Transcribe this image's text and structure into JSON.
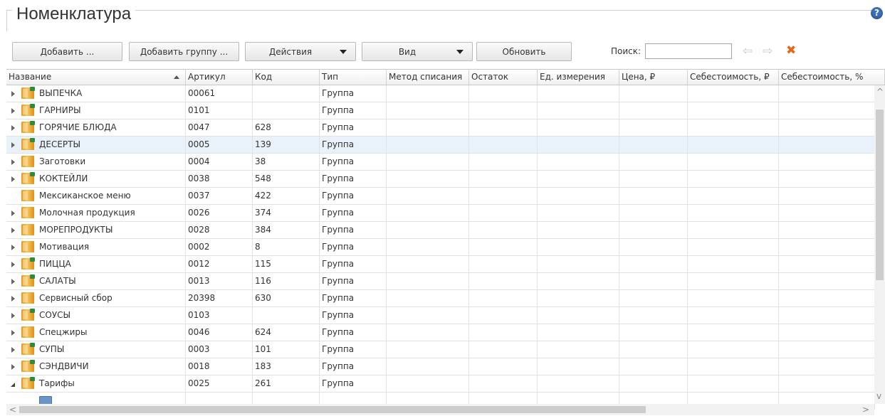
{
  "title": "Номенклатура",
  "help_icon": "?",
  "toolbar": {
    "add": "Добавить ...",
    "add_group": "Добавить группу ...",
    "actions": "Действия",
    "view": "Вид",
    "refresh": "Обновить",
    "search_label": "Поиск:",
    "search_value": ""
  },
  "icons": {
    "back": "⇦",
    "forward": "⇨",
    "clear": "✖"
  },
  "columns": [
    "Название",
    "Артикул",
    "Код",
    "Тип",
    "Метод списания",
    "Остаток",
    "Ед. измерения",
    "Цена, ₽",
    "Себестоимость, ₽",
    "Себестоимость, %"
  ],
  "rows": [
    {
      "name": "ВЫПЕЧКА",
      "article": "00061",
      "code": "",
      "type": "Группа",
      "expander": "closed",
      "tag": true
    },
    {
      "name": "ГАРНИРЫ",
      "article": "0101",
      "code": "",
      "type": "Группа",
      "expander": "closed",
      "tag": true
    },
    {
      "name": "ГОРЯЧИЕ БЛЮДА",
      "article": "0047",
      "code": "628",
      "type": "Группа",
      "expander": "closed",
      "tag": true
    },
    {
      "name": "ДЕСЕРТЫ",
      "article": "0005",
      "code": "139",
      "type": "Группа",
      "expander": "closed",
      "tag": true,
      "selected": true
    },
    {
      "name": "Заготовки",
      "article": "0004",
      "code": "38",
      "type": "Группа",
      "expander": "closed",
      "tag": false
    },
    {
      "name": "КОКТЕЙЛИ",
      "article": "0038",
      "code": "548",
      "type": "Группа",
      "expander": "closed",
      "tag": true
    },
    {
      "name": "Мексиканское меню",
      "article": "0037",
      "code": "422",
      "type": "Группа",
      "expander": "none",
      "tag": false
    },
    {
      "name": "Молочная продукция",
      "article": "0026",
      "code": "374",
      "type": "Группа",
      "expander": "closed",
      "tag": false
    },
    {
      "name": "МОРЕПРОДУКТЫ",
      "article": "0028",
      "code": "384",
      "type": "Группа",
      "expander": "closed",
      "tag": false
    },
    {
      "name": "Мотивация",
      "article": "0002",
      "code": "8",
      "type": "Группа",
      "expander": "closed",
      "tag": false
    },
    {
      "name": "ПИЦЦА",
      "article": "0012",
      "code": "115",
      "type": "Группа",
      "expander": "closed",
      "tag": true
    },
    {
      "name": "САЛАТЫ",
      "article": "0013",
      "code": "116",
      "type": "Группа",
      "expander": "closed",
      "tag": true
    },
    {
      "name": "Сервисный сбор",
      "article": "20398",
      "code": "630",
      "type": "Группа",
      "expander": "closed",
      "tag": false
    },
    {
      "name": "СОУСЫ",
      "article": "0103",
      "code": "",
      "type": "Группа",
      "expander": "closed",
      "tag": true
    },
    {
      "name": "Спецжиры",
      "article": "0046",
      "code": "624",
      "type": "Группа",
      "expander": "closed",
      "tag": false
    },
    {
      "name": "СУПЫ",
      "article": "0003",
      "code": "101",
      "type": "Группа",
      "expander": "closed",
      "tag": true
    },
    {
      "name": "СЭНДВИЧИ",
      "article": "0018",
      "code": "183",
      "type": "Группа",
      "expander": "closed",
      "tag": true
    },
    {
      "name": "Тарифы",
      "article": "0025",
      "code": "261",
      "type": "Группа",
      "expander": "open",
      "tag": true
    }
  ],
  "scroll": {
    "up": "^",
    "down": "v",
    "left": "<",
    "right": ">"
  }
}
